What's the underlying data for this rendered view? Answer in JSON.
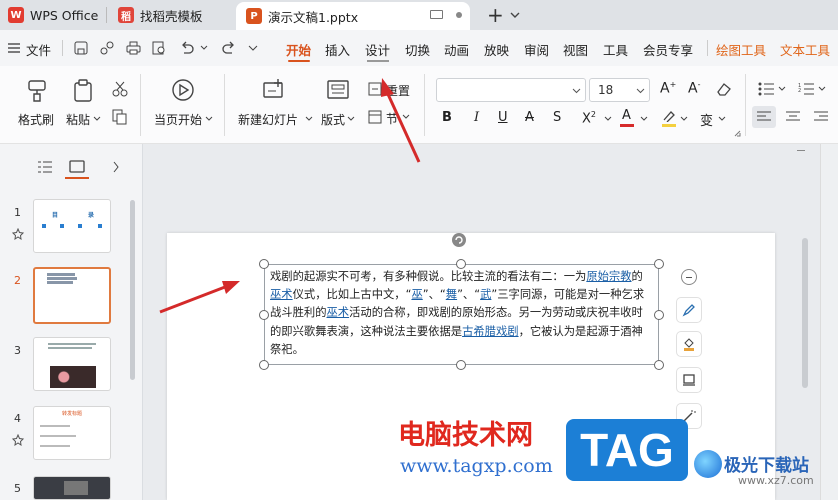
{
  "tabs": [
    {
      "label": "WPS Office"
    },
    {
      "label": "找稻壳模板"
    },
    {
      "label": "演示文稿1.pptx"
    }
  ],
  "tabbar": {
    "add_label": "+"
  },
  "menu": {
    "file": "文件",
    "items": [
      "开始",
      "插入",
      "设计",
      "切换",
      "动画",
      "放映",
      "审阅",
      "视图",
      "工具",
      "会员专享"
    ],
    "extra": [
      "绘图工具",
      "文本工具"
    ]
  },
  "ribbon": {
    "format_painter": "格式刷",
    "paste": "粘贴",
    "play_from_current": "当页开始",
    "new_slide": "新建幻灯片",
    "layout": "版式",
    "reset": "重置",
    "section": "节",
    "font_name": "",
    "font_size": "18"
  },
  "slides": [
    "1",
    "2",
    "3",
    "4",
    "5"
  ],
  "slide_thumbs": {
    "1": {
      "left": "目",
      "right": "录"
    },
    "4": {
      "title": "转发标题"
    }
  },
  "textbox": {
    "p1": "戏剧的起源实不可考，有多种假说。比较主流的看法有二：一为",
    "link1": "原始宗教",
    "p2": "的",
    "link2": "巫术",
    "p3": "仪式，比如上古中文，“",
    "link3": "巫",
    "p4": "”、“",
    "link4": "舞",
    "p5": "”、“",
    "link5": "武",
    "p6": "”三字同源，可能是对一种乞求战斗胜利的",
    "link6": "巫术",
    "p7": "活动的合称，即戏剧的原始形态。另一为劳动或庆祝丰收时的即兴歌舞表演，这种说法主要依据是",
    "link7": "古希腊戏剧",
    "p8": "，它被认为是起源于酒神祭祀。"
  },
  "watermark": {
    "site_name": "电脑技术网",
    "site_url": "www.tagxp.com",
    "tag": "TAG",
    "brand": "极光下载站",
    "brand_url": "www.xz7.com"
  },
  "colors": {
    "accent": "#d9531e",
    "link": "#1b5fa6",
    "arrow": "#d42a2a",
    "tag_blue": "#1c7fd6"
  }
}
